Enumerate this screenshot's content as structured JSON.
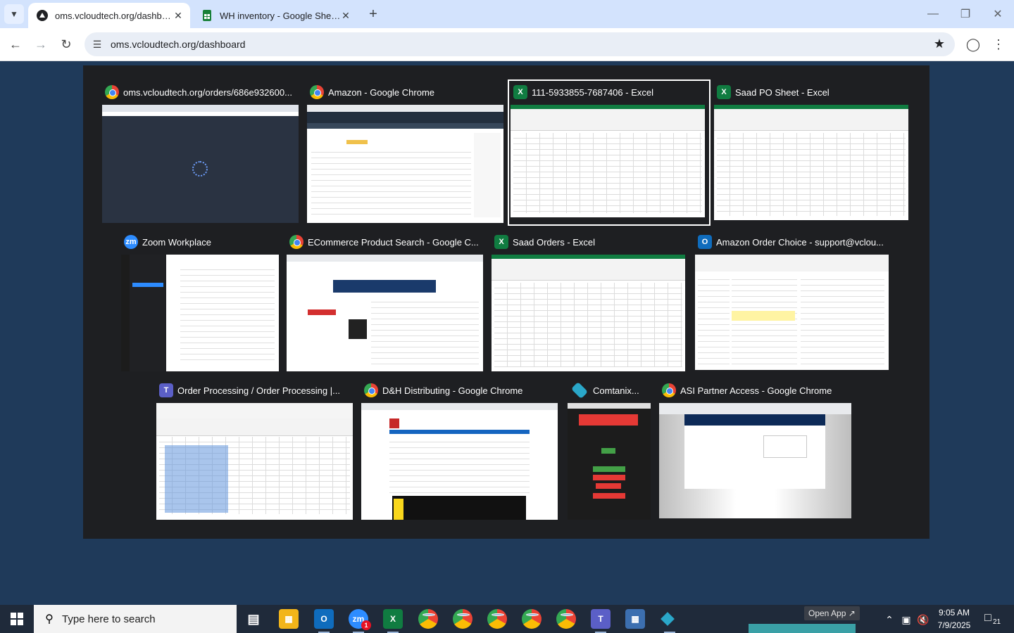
{
  "browser": {
    "tabs": [
      {
        "title": "oms.vcloudtech.org/dashboard",
        "active": true
      },
      {
        "title": "WH inventory - Google Sheets",
        "active": false
      }
    ],
    "address": "oms.vcloudtech.org/dashboard"
  },
  "switcher": {
    "windows": [
      {
        "title": "oms.vcloudtech.org/orders/686e932600...",
        "app": "chrome"
      },
      {
        "title": "Amazon - Google Chrome",
        "app": "chrome"
      },
      {
        "title": "111-5933855-7687406 - Excel",
        "app": "excel",
        "selected": true
      },
      {
        "title": "Saad PO Sheet - Excel",
        "app": "excel"
      },
      {
        "title": "Zoom Workplace",
        "app": "zoom"
      },
      {
        "title": "ECommerce Product Search - Google C...",
        "app": "chrome"
      },
      {
        "title": "Saad Orders - Excel",
        "app": "excel"
      },
      {
        "title": "Amazon Order Choice - support@vclou...",
        "app": "outlook"
      },
      {
        "title": "Order Processing / Order Processing |...",
        "app": "teams"
      },
      {
        "title": "D&H Distributing - Google Chrome",
        "app": "chrome"
      },
      {
        "title": "Comtanix...",
        "app": "comtanix"
      },
      {
        "title": "ASI Partner Access - Google Chrome",
        "app": "chrome"
      }
    ]
  },
  "taskbar": {
    "search_placeholder": "Type here to search",
    "zoom_badge": "1",
    "open_app_label": "Open App ↗",
    "time": "9:05 AM",
    "date": "7/9/2025",
    "notification_count": "21"
  },
  "colors": {
    "switcher_bg": "#1e1f22",
    "tabstrip": "#d3e3fd",
    "taskbar": "#1f2a3a",
    "excel": "#107c41",
    "chrome_red": "#ea4335"
  }
}
